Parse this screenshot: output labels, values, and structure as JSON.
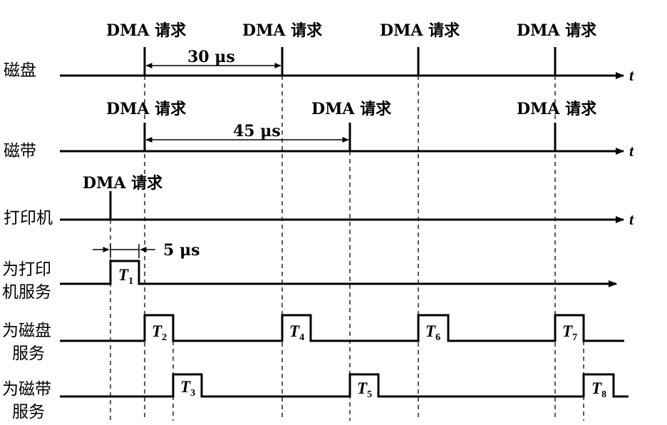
{
  "request_label": "DMA 请求",
  "axis_label": "t",
  "rows": {
    "disk": "磁盘",
    "tape": "磁带",
    "printer": "打印机",
    "serve_printer": [
      "为打印",
      "机服务"
    ],
    "serve_disk": [
      "为磁盘",
      "服务"
    ],
    "serve_tape": [
      "为磁带",
      "服务"
    ]
  },
  "intervals": {
    "disk": "30 μs",
    "tape": "45 μs",
    "service": "5 μs"
  },
  "service_periods": {
    "printer": [
      {
        "name": "T",
        "sub": "1"
      }
    ],
    "disk": [
      {
        "name": "T",
        "sub": "2"
      },
      {
        "name": "T",
        "sub": "4"
      },
      {
        "name": "T",
        "sub": "6"
      },
      {
        "name": "T",
        "sub": "7"
      }
    ],
    "tape": [
      {
        "name": "T",
        "sub": "3"
      },
      {
        "name": "T",
        "sub": "5"
      },
      {
        "name": "T",
        "sub": "8"
      }
    ]
  }
}
